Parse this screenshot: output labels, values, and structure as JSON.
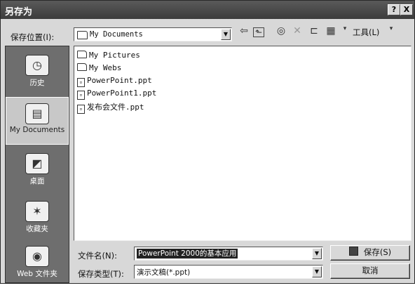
{
  "dialog": {
    "title": "另存为",
    "help_label": "?",
    "close_label": "X"
  },
  "toolbar": {
    "location_label": "保存位置(I):",
    "location_value": "My Documents",
    "tools_label": "工具(L)",
    "icons": [
      "back-icon",
      "up-folder-icon",
      "search-web-icon",
      "delete-icon",
      "new-folder-icon",
      "views-icon"
    ]
  },
  "sidebar": {
    "items": [
      {
        "label": "历史",
        "icon": "history-icon"
      },
      {
        "label": "My Documents",
        "icon": "my-documents-icon"
      },
      {
        "label": "桌面",
        "icon": "desktop-icon"
      },
      {
        "label": "收藏夹",
        "icon": "favorites-icon"
      },
      {
        "label": "Web 文件夹",
        "icon": "web-folders-icon"
      }
    ]
  },
  "files": [
    {
      "name": "My Pictures",
      "type": "folder"
    },
    {
      "name": "My Webs",
      "type": "folder"
    },
    {
      "name": "PowerPoint.ppt",
      "type": "ppt"
    },
    {
      "name": "PowerPoint1.ppt",
      "type": "ppt"
    },
    {
      "name": "发布会文件.ppt",
      "type": "ppt"
    }
  ],
  "filename": {
    "label": "文件名(N):",
    "value": "PowerPoint 2000的基本应用"
  },
  "filetype": {
    "label": "保存类型(T):",
    "value": "演示文稿(*.ppt)"
  },
  "buttons": {
    "save": "保存(S)",
    "cancel": "取消"
  }
}
